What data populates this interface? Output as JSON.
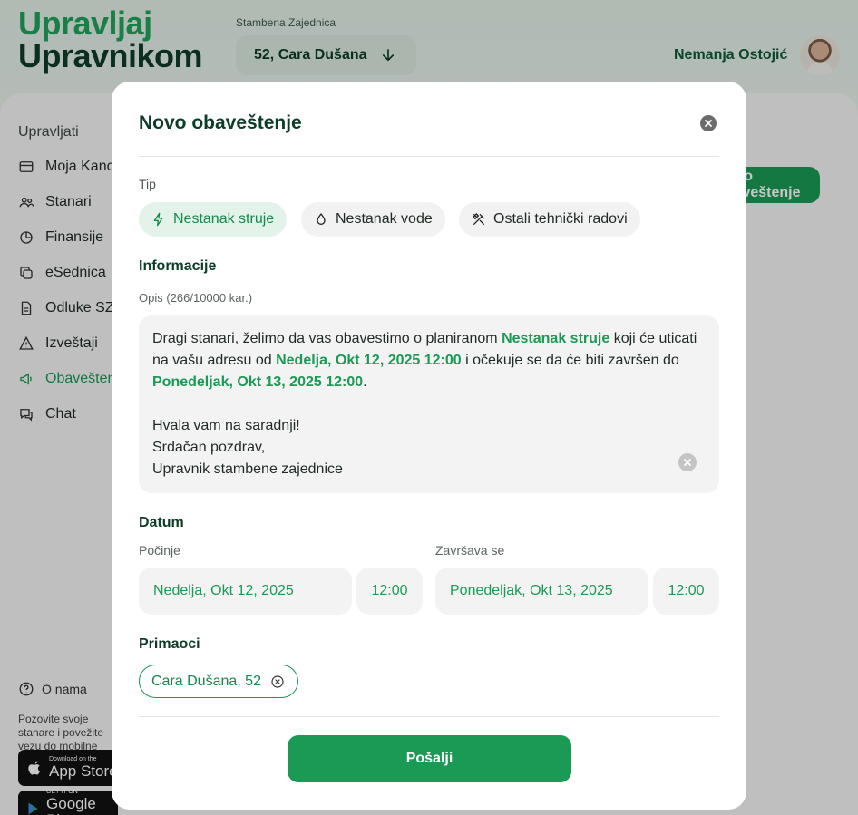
{
  "header": {
    "logo_line1": "Upravljaj",
    "logo_line2": "Upravnikom",
    "community_label": "Stambena Zajednica",
    "community_value": "52, Cara Dušana",
    "user_name": "Nemanja Ostojić"
  },
  "sidebar": {
    "heading": "Upravljati",
    "items": [
      {
        "label": "Moja Kancelarija",
        "icon": "wallet-icon"
      },
      {
        "label": "Stanari",
        "icon": "users-icon"
      },
      {
        "label": "Finansije",
        "icon": "pie-chart-icon"
      },
      {
        "label": "eSednica",
        "icon": "copy-icon"
      },
      {
        "label": "Odluke SZ",
        "icon": "document-icon"
      },
      {
        "label": "Izveštaji",
        "icon": "warning-icon"
      },
      {
        "label": "Obaveštenja",
        "icon": "megaphone-icon"
      },
      {
        "label": "Chat",
        "icon": "chat-icon"
      }
    ],
    "about": "O nama",
    "invite_text": "Pozovite svoje stanare i povežite vezu do mobilne aplikacije",
    "app_store_small": "Download on the",
    "app_store_big": "App Store",
    "google_play_small": "GET IT ON",
    "google_play_big": "Google Play"
  },
  "background_button": "Novo obaveštenje",
  "modal": {
    "title": "Novo obaveštenje",
    "type_label": "Tip",
    "types": [
      {
        "label": "Nestanak struje",
        "icon": "lightning-icon",
        "selected": true
      },
      {
        "label": "Nestanak vode",
        "icon": "water-drop-icon",
        "selected": false
      },
      {
        "label": "Ostali tehnički radovi",
        "icon": "tools-icon",
        "selected": false
      }
    ],
    "info_title": "Informacije",
    "desc_label": "Opis (266/10000 kar.)",
    "desc": {
      "p1_a": "Dragi stanari, želimo da vas obavestimo o planiranom ",
      "p1_type": "Nestanak struje",
      "p1_b": " koji će uticati na vašu adresu od ",
      "p1_start": "Nedelja, Okt 12, 2025 12:00",
      "p1_c": " i očekuje se da će biti završen do ",
      "p1_end": "Ponedeljak, Okt 13, 2025 12:00",
      "p1_d": ".",
      "l2": "Hvala vam na saradnji!",
      "l3": "Srdačan pozdrav,",
      "l4": "Upravnik stambene zajednice"
    },
    "date_title": "Datum",
    "start_label": "Počinje",
    "start_date": "Nedelja, Okt 12, 2025",
    "start_time": "12:00",
    "end_label": "Završava se",
    "end_date": "Ponedeljak, Okt 13, 2025",
    "end_time": "12:00",
    "recipients_title": "Primaoci",
    "recipient": "Cara Dušana, 52",
    "send_label": "Pošalji"
  },
  "colors": {
    "accent": "#1a9a55",
    "dark_green": "#0d3d28",
    "chip_selected_bg": "#e3f3e9"
  }
}
